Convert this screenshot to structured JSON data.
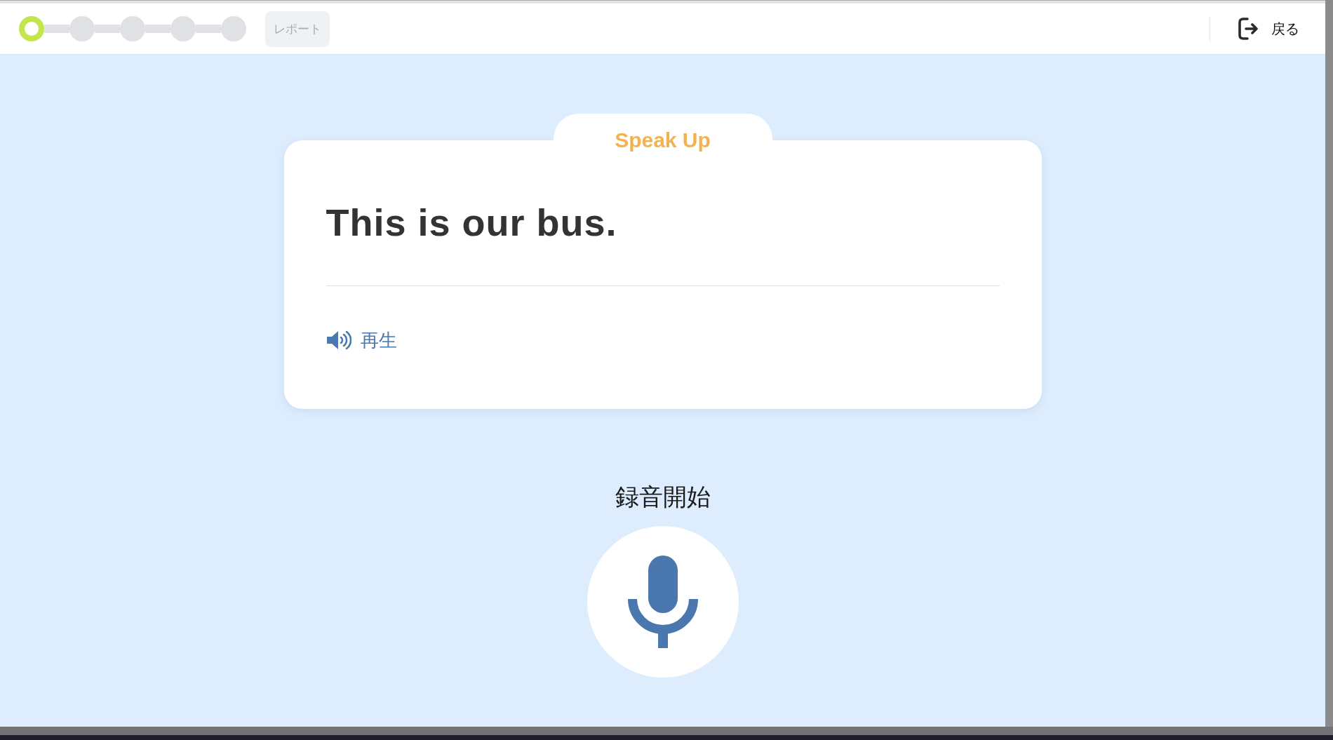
{
  "progress": {
    "steps": [
      {
        "current": true
      },
      {
        "current": false
      },
      {
        "current": false
      },
      {
        "current": false
      },
      {
        "current": false
      }
    ]
  },
  "report_button": {
    "label": "レポート",
    "disabled": true
  },
  "back_button": {
    "label": "戻る"
  },
  "card": {
    "tab_title": "Speak Up",
    "sentence": "This is our bus.",
    "play_button": {
      "label": "再生"
    }
  },
  "record": {
    "label": "録音開始"
  }
}
